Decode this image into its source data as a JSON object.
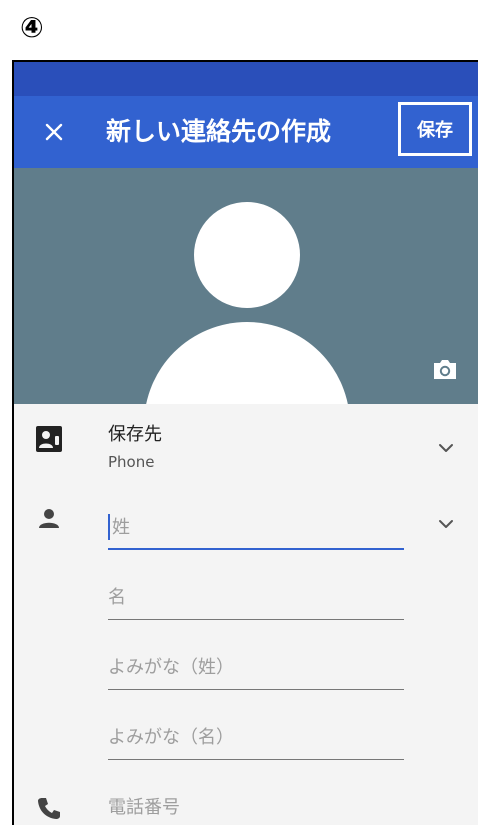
{
  "step_marker": "④",
  "app_bar": {
    "close_icon": "close-icon",
    "title": "新しい連絡先の作成",
    "save_label": "保存"
  },
  "photo": {
    "avatar_icon": "avatar-placeholder",
    "camera_icon": "camera-icon"
  },
  "form": {
    "save_to": {
      "icon": "contact-card-icon",
      "label": "保存先",
      "value": "Phone"
    },
    "name_fields": {
      "icon": "person-icon",
      "last_name_placeholder": "姓",
      "first_name_placeholder": "名",
      "last_name_reading_placeholder": "よみがな（姓）",
      "first_name_reading_placeholder": "よみがな（名）"
    },
    "phone": {
      "icon": "phone-icon",
      "placeholder": "電話番号"
    }
  },
  "colors": {
    "status_bar": "#2a4fba",
    "app_bar": "#3262d0",
    "photo_bg": "#607d8b",
    "form_bg": "#f4f4f4",
    "accent": "#3262d0"
  }
}
